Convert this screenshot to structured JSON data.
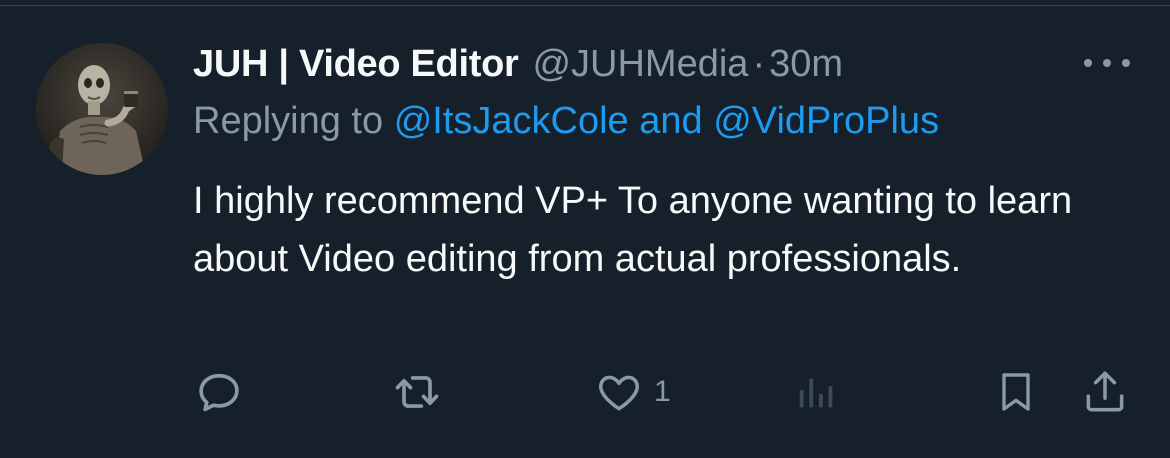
{
  "tweet": {
    "display_name": "JUH | Video Editor",
    "handle": "@JUHMedia",
    "separator": "·",
    "time": "30m",
    "replying_prefix": "Replying to",
    "replying_user1": "@ItsJackCole",
    "replying_and": "and",
    "replying_user2": "@VidProPlus",
    "text": "I highly recommend VP+ To anyone wanting to learn about Video editing from actual professionals."
  },
  "actions": {
    "reply_icon": "reply-icon",
    "retweet_icon": "retweet-icon",
    "like_icon": "heart-icon",
    "like_count": "1",
    "views_icon": "analytics-icon",
    "bookmark_icon": "bookmark-icon",
    "share_icon": "share-icon"
  },
  "colors": {
    "background": "#15202b",
    "text_primary": "#f7f9f9",
    "text_secondary": "#8b98a5",
    "link": "#1d9bf0",
    "views_muted": "#3e4a55"
  }
}
